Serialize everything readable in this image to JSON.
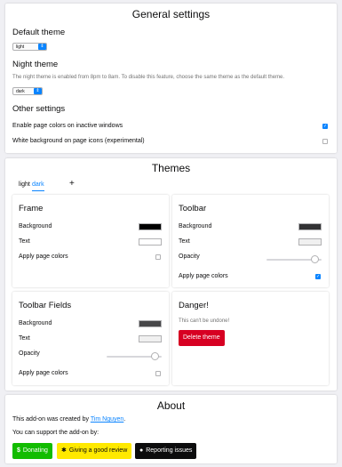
{
  "general": {
    "title": "General settings",
    "default_theme_heading": "Default theme",
    "default_theme_value": "light",
    "night_theme_heading": "Night theme",
    "night_theme_description": "The night theme is enabled from 8pm to 8am. To disable this feature, choose the same theme as the default theme.",
    "night_theme_value": "dark",
    "other_heading": "Other settings",
    "option1_label": "Enable page colors on inactive windows",
    "option1_checked": true,
    "option2_label": "White background on page icons (experimental)",
    "option2_checked": false
  },
  "themes": {
    "title": "Themes",
    "tabs": [
      "light",
      "dark",
      "+"
    ],
    "active_tab": "dark",
    "frame": {
      "heading": "Frame",
      "background_label": "Background",
      "background_color": "#000000",
      "text_label": "Text",
      "text_color": "#ffffff",
      "apply_label": "Apply page colors",
      "apply_checked": false
    },
    "toolbar": {
      "heading": "Toolbar",
      "background_label": "Background",
      "background_color": "#323234",
      "text_label": "Text",
      "text_color": "#f9f9fa",
      "opacity_label": "Opacity",
      "opacity_value": 1,
      "apply_label": "Apply page colors",
      "apply_checked": true
    },
    "toolbar_fields": {
      "heading": "Toolbar Fields",
      "background_label": "Background",
      "background_color": "#474749",
      "text_label": "Text",
      "text_color": "#f9f9fa",
      "opacity_label": "Opacity",
      "opacity_value": 1,
      "apply_label": "Apply page colors",
      "apply_checked": false
    },
    "danger": {
      "heading": "Danger!",
      "warning": "This can't be undone!",
      "delete_label": "Delete theme"
    }
  },
  "about": {
    "title": "About",
    "created_prefix": "This add-on was created by ",
    "author": "Tim Nguyen",
    "created_suffix": ".",
    "support_text": "You can support the add-on by:",
    "donate_label": "Donating",
    "review_label": "Giving a good review",
    "issues_label": "Reporting issues"
  },
  "colors": {
    "accent": "#0a84ff",
    "danger": "#d70022",
    "donate_green": "#12bc00",
    "review_yellow": "#ffe900",
    "issues_black": "#0c0c0d"
  }
}
